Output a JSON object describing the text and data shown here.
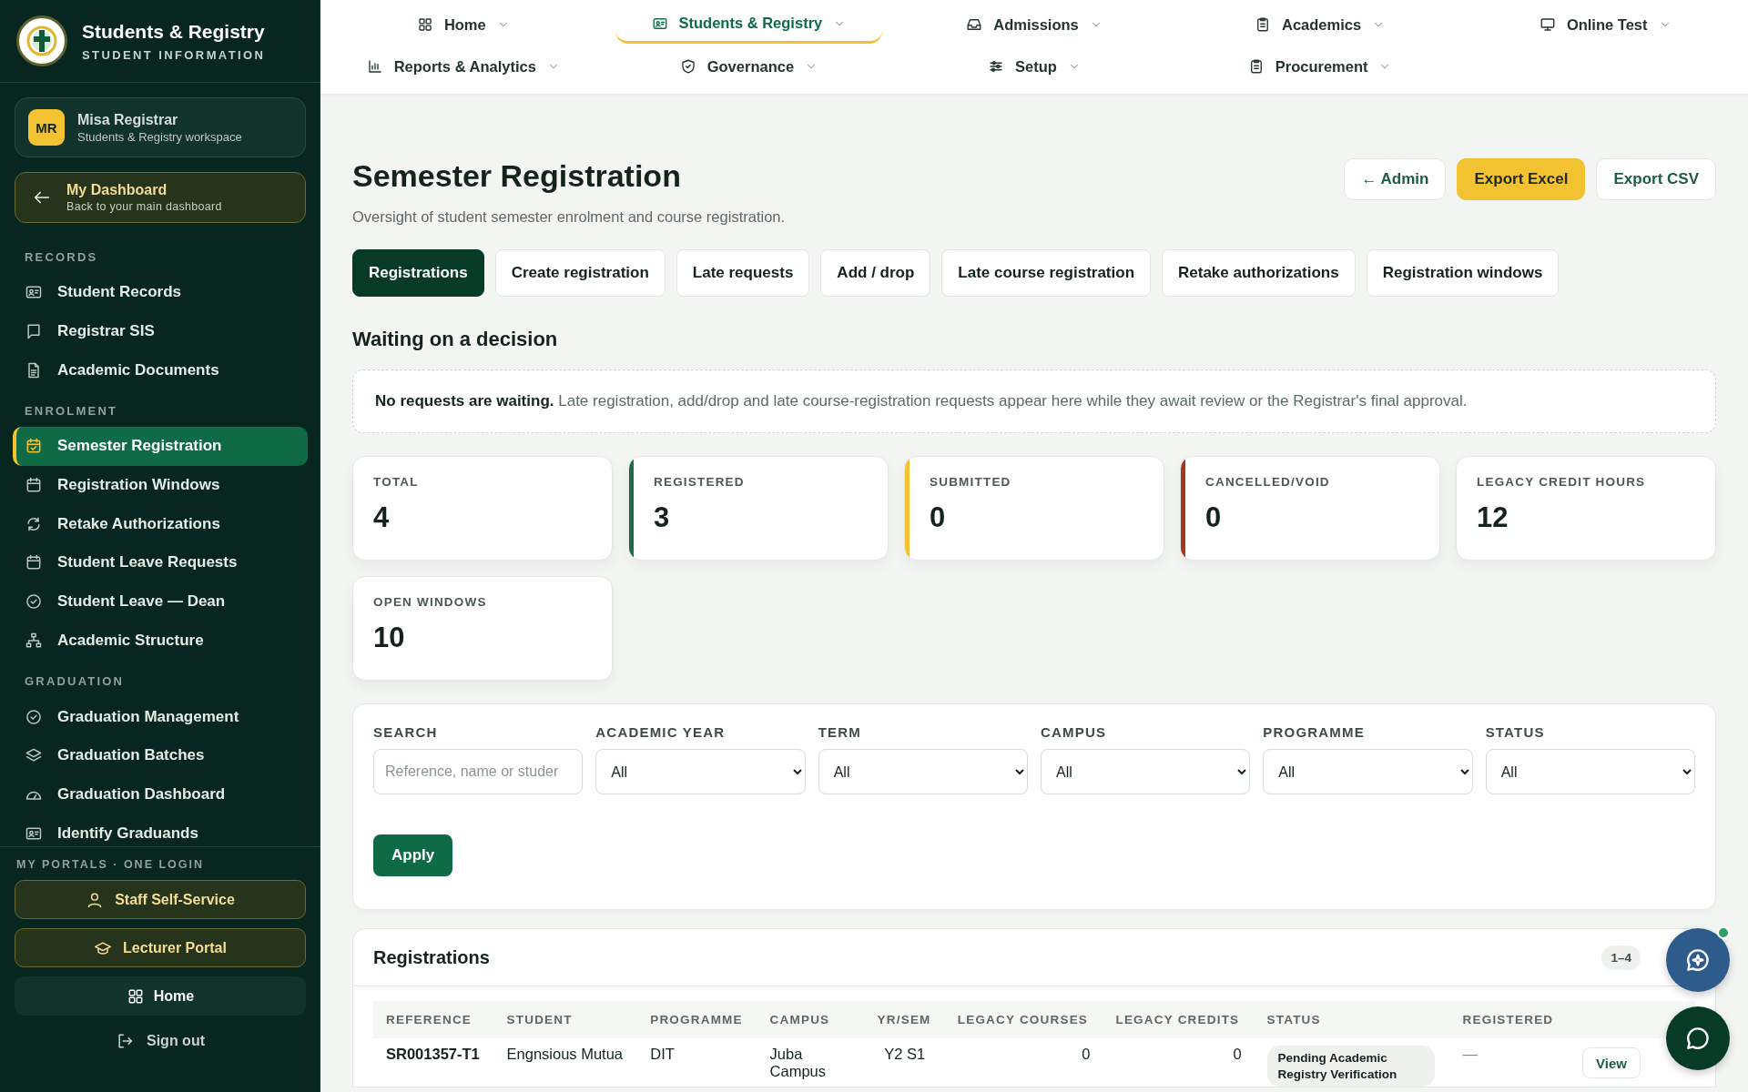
{
  "sidebar": {
    "brand": {
      "title": "Students & Registry",
      "subtitle": "STUDENT INFORMATION"
    },
    "user": {
      "initials": "MR",
      "name": "Misa Registrar",
      "workspace": "Students & Registry workspace"
    },
    "dashboard_link": {
      "title": "My Dashboard",
      "subtitle": "Back to your main dashboard"
    },
    "sections": [
      {
        "heading": "RECORDS",
        "items": [
          {
            "label": "Student Records",
            "selected": false
          },
          {
            "label": "Registrar SIS",
            "selected": false
          },
          {
            "label": "Academic Documents",
            "selected": false
          }
        ]
      },
      {
        "heading": "ENROLMENT",
        "items": [
          {
            "label": "Semester Registration",
            "selected": true
          },
          {
            "label": "Registration Windows",
            "selected": false
          },
          {
            "label": "Retake Authorizations",
            "selected": false
          },
          {
            "label": "Student Leave Requests",
            "selected": false
          },
          {
            "label": "Student Leave — Dean",
            "selected": false
          },
          {
            "label": "Academic Structure",
            "selected": false
          }
        ]
      },
      {
        "heading": "GRADUATION",
        "items": [
          {
            "label": "Graduation Management",
            "selected": false
          },
          {
            "label": "Graduation Batches",
            "selected": false
          },
          {
            "label": "Graduation Dashboard",
            "selected": false
          },
          {
            "label": "Identify Graduands",
            "selected": false
          }
        ]
      }
    ],
    "portals": {
      "heading": "MY PORTALS · ONE LOGIN",
      "buttons": [
        "Staff Self-Service",
        "Lecturer Portal"
      ]
    },
    "home_button": "Home",
    "sign_out": "Sign out"
  },
  "top_nav": [
    {
      "label": "Home",
      "selected": false
    },
    {
      "label": "Students & Registry",
      "selected": true
    },
    {
      "label": "Admissions",
      "selected": false
    },
    {
      "label": "Academics",
      "selected": false
    },
    {
      "label": "Online Test",
      "selected": false
    },
    {
      "label": "Reports & Analytics",
      "selected": false
    },
    {
      "label": "Governance",
      "selected": false
    },
    {
      "label": "Setup",
      "selected": false
    },
    {
      "label": "Procurement",
      "selected": false
    }
  ],
  "page": {
    "title": "Semester Registration",
    "subtitle": "Oversight of student semester enrolment and course registration.",
    "actions": [
      {
        "label": "← Admin",
        "kind": "outline"
      },
      {
        "label": "Export Excel",
        "kind": "primary"
      },
      {
        "label": "Export CSV",
        "kind": "outline"
      }
    ]
  },
  "tabs": [
    {
      "label": "Registrations",
      "selected": true
    },
    {
      "label": "Create registration",
      "selected": false
    },
    {
      "label": "Late requests",
      "selected": false
    },
    {
      "label": "Add / drop",
      "selected": false
    },
    {
      "label": "Late course registration",
      "selected": false
    },
    {
      "label": "Retake authorizations",
      "selected": false
    },
    {
      "label": "Registration windows",
      "selected": false
    }
  ],
  "waiting": {
    "heading": "Waiting on a decision",
    "message": "**No requests are waiting.** Late registration, add/drop and late course-registration requests appear here while they await review or the Registrar's final approval."
  },
  "stats": [
    {
      "label": "TOTAL",
      "value": "4"
    },
    {
      "label": "REGISTERED",
      "value": "3",
      "color": "#1c6b48"
    },
    {
      "label": "SUBMITTED",
      "value": "0",
      "color": "#f2c230"
    },
    {
      "label": "CANCELLED/VOID",
      "value": "0",
      "color": "#a33a20"
    },
    {
      "label": "LEGACY CREDIT HOURS",
      "value": "12"
    },
    {
      "label": "OPEN WINDOWS",
      "value": "10"
    }
  ],
  "filters": {
    "search": {
      "label": "SEARCH",
      "placeholder": "Reference, name or studer"
    },
    "selects": [
      {
        "label": "ACADEMIC YEAR",
        "value": "All"
      },
      {
        "label": "TERM",
        "value": "All"
      },
      {
        "label": "CAMPUS",
        "value": "All"
      },
      {
        "label": "PROGRAMME",
        "value": "All"
      },
      {
        "label": "STATUS",
        "value": "All"
      }
    ],
    "apply": "Apply"
  },
  "table": {
    "title": "Registrations",
    "range": "1–4",
    "columns": [
      "REFERENCE",
      "STUDENT",
      "PROGRAMME",
      "CAMPUS",
      "YR/SEM",
      "LEGACY COURSES",
      "LEGACY CREDITS",
      "STATUS",
      "REGISTERED"
    ],
    "rows": [
      {
        "reference": "SR001357-T1",
        "student": "Engnsious Mutua",
        "programme": "DIT",
        "campus": "Juba Campus",
        "yr_sem": "Y2 S1",
        "legacy_courses": "0",
        "legacy_credits": "0",
        "status": "Pending Academic Registry Verification",
        "registered": "—",
        "action": "View"
      }
    ]
  },
  "assistant": {
    "online": true
  }
}
